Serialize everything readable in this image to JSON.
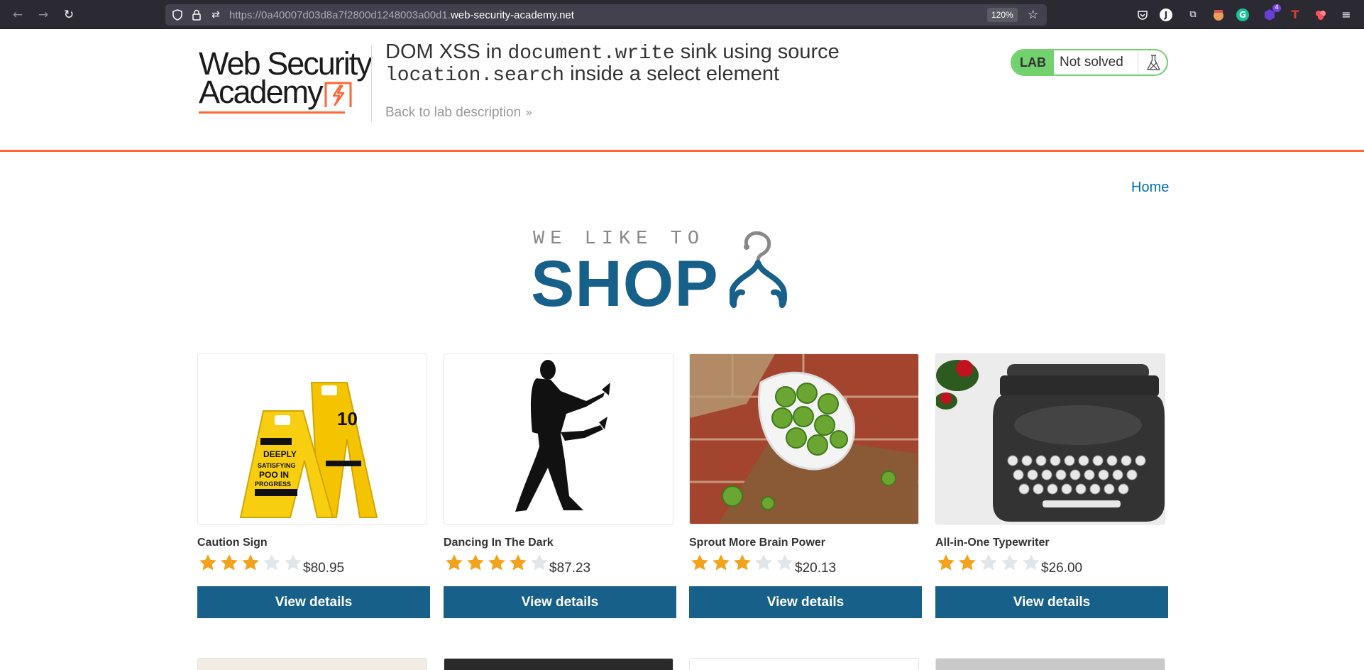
{
  "browser": {
    "url_dim": "https://0a40007d03d8a7f2800d1248003a00d1.",
    "url_domain": "web-security-academy.net",
    "zoom": "120%",
    "extension_badge": "4"
  },
  "lab": {
    "logo_line1": "Web Security",
    "logo_line2": "Academy",
    "title_part1": "DOM XSS in ",
    "title_code1": "document.write",
    "title_part2": " sink using source ",
    "title_code2": "location.search",
    "title_part3": " inside a select element",
    "back_link": "Back to lab description",
    "status_pill": "LAB",
    "status_text": "Not solved",
    "colors": {
      "accent": "#ff6633",
      "lab_green": "#70d16d"
    }
  },
  "nav": {
    "home": "Home"
  },
  "shop_logo": {
    "tagline": "WE LIKE TO",
    "word": "SHOP",
    "brand_color": "#176089"
  },
  "products": [
    {
      "name": "Caution Sign",
      "rating": 3,
      "max_rating": 5,
      "price": "$80.95",
      "button": "View details"
    },
    {
      "name": "Dancing In The Dark",
      "rating": 4,
      "max_rating": 5,
      "price": "$87.23",
      "button": "View details"
    },
    {
      "name": "Sprout More Brain Power",
      "rating": 3,
      "max_rating": 5,
      "price": "$20.13",
      "button": "View details"
    },
    {
      "name": "All-in-One Typewriter",
      "rating": 2,
      "max_rating": 5,
      "price": "$26.00",
      "button": "View details"
    }
  ]
}
